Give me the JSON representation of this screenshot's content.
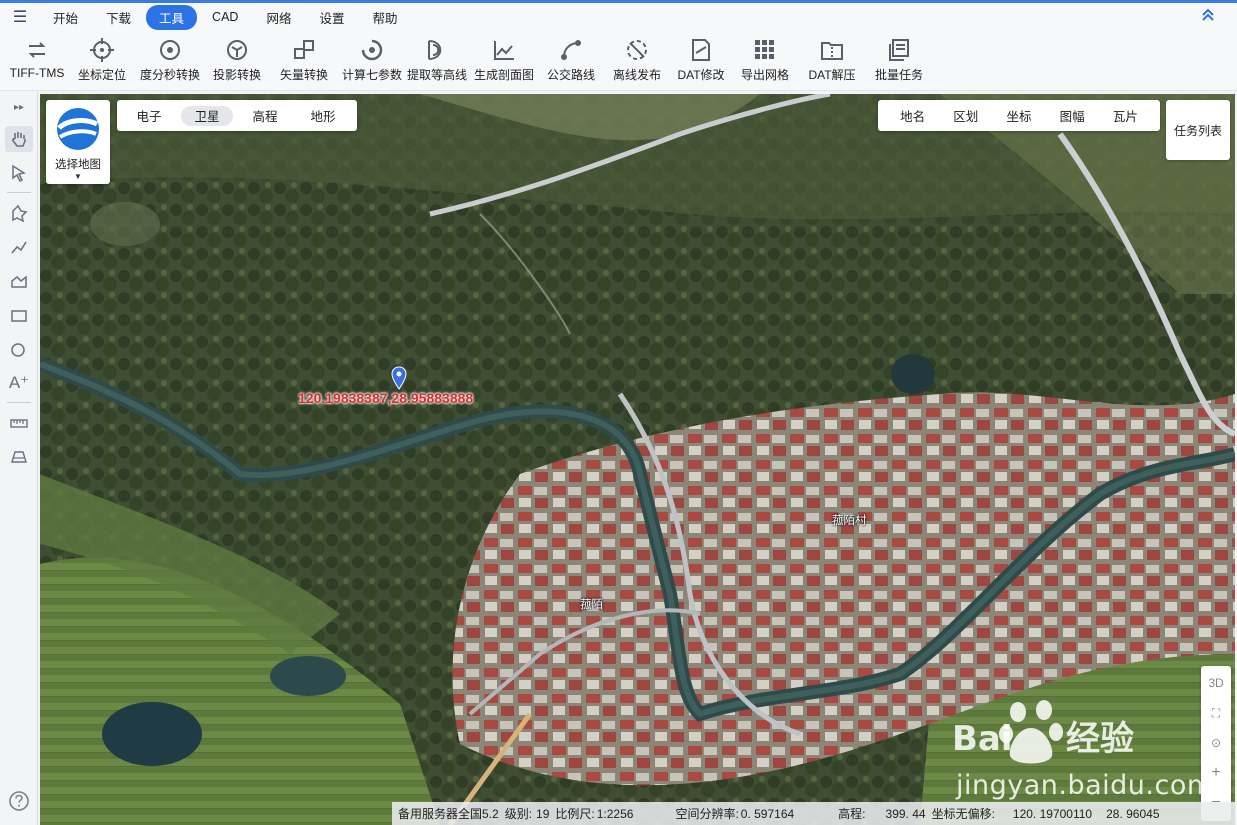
{
  "menubar": {
    "items": [
      {
        "label": "开始",
        "active": false
      },
      {
        "label": "下载",
        "active": false
      },
      {
        "label": "工具",
        "active": true
      },
      {
        "label": "CAD",
        "active": false
      },
      {
        "label": "网络",
        "active": false
      },
      {
        "label": "设置",
        "active": false
      },
      {
        "label": "帮助",
        "active": false
      }
    ],
    "menu_icon": "hamburger-icon",
    "collapse_icon": "double-chevron-up-icon"
  },
  "toolbar": {
    "tools": [
      {
        "label": "TIFF-TMS",
        "icon": "swap-icon"
      },
      {
        "label": "坐标定位",
        "icon": "crosshair-icon"
      },
      {
        "label": "度分秒转换",
        "icon": "degree-icon"
      },
      {
        "label": "投影转换",
        "icon": "projection-icon"
      },
      {
        "label": "矢量转换",
        "icon": "vector-icon"
      },
      {
        "label": "计算七参数",
        "icon": "calculate-icon"
      },
      {
        "label": "提取等高线",
        "icon": "contour-icon"
      },
      {
        "label": "生成剖面图",
        "icon": "profile-icon"
      },
      {
        "label": "公交路线",
        "icon": "bus-route-icon"
      },
      {
        "label": "离线发布",
        "icon": "offline-publish-icon"
      },
      {
        "label": "DAT修改",
        "icon": "dat-edit-icon"
      },
      {
        "label": "导出网格",
        "icon": "grid-export-icon"
      },
      {
        "label": "DAT解压",
        "icon": "dat-unzip-icon"
      },
      {
        "label": "批量任务",
        "icon": "batch-task-icon"
      }
    ]
  },
  "map": {
    "select_map_label": "选择地图",
    "map_types": [
      {
        "label": "电子",
        "active": false
      },
      {
        "label": "卫星",
        "active": true
      },
      {
        "label": "高程",
        "active": false
      },
      {
        "label": "地形",
        "active": false
      }
    ],
    "layers": [
      "地名",
      "区划",
      "坐标",
      "图幅",
      "瓦片"
    ],
    "task_list_label": "任务列表",
    "marker_coordinate": "120.19838387,28.95883888",
    "place_labels": [
      "菰陌村",
      "菰陌"
    ],
    "controls": [
      "3D",
      "⛶",
      "⊙",
      "+",
      "−"
    ],
    "watermark": "jingyan.baidu.com"
  },
  "statusbar": {
    "server": "备用服务器全国5.2",
    "level_label": "级别:",
    "level_value": "19",
    "scale_label": "比例尺:",
    "scale_value": "1:2256",
    "resolution_label": "空间分辨率:",
    "resolution_value": "0. 597164",
    "elevation_label": "高程:",
    "elevation_value": "399. 44",
    "coord_label": "坐标无偏移:",
    "coord_x": "120. 19700110",
    "coord_y": "28. 96045"
  },
  "colors": {
    "accent": "#2e73e6",
    "marker_text": "#e02a2a"
  }
}
